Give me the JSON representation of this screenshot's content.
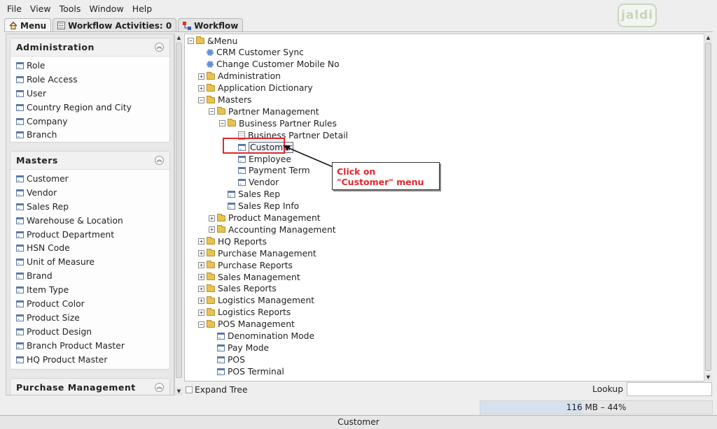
{
  "menubar": {
    "items": [
      "File",
      "View",
      "Tools",
      "Window",
      "Help"
    ]
  },
  "logo_text": "jaldi",
  "tabs": [
    {
      "label": "Menu",
      "icon": "home-icon"
    },
    {
      "label": "Workflow Activities: 0",
      "icon": "list-icon"
    },
    {
      "label": "Workflow",
      "icon": "workflow-icon"
    }
  ],
  "left": {
    "sections": [
      {
        "title": "Administration",
        "items": [
          "Role",
          "Role Access",
          "User",
          "Country Region and City",
          "Company",
          "Branch"
        ]
      },
      {
        "title": "Masters",
        "items": [
          "Customer",
          "Vendor",
          "Sales Rep",
          "Warehouse & Location",
          "Product Department",
          "HSN Code",
          "Unit of Measure",
          "Brand",
          "Item Type",
          "Product Color",
          "Product Size",
          "Product Design",
          "Branch Product Master",
          "HQ Product Master"
        ]
      },
      {
        "title": "Purchase Management",
        "items": []
      }
    ]
  },
  "tree": {
    "rows": [
      {
        "label": "&Menu",
        "level": 0,
        "type": "folder-open"
      },
      {
        "label": "CRM Customer Sync",
        "level": 1,
        "type": "process"
      },
      {
        "label": "Change Customer Mobile No",
        "level": 1,
        "type": "process"
      },
      {
        "label": "Administration",
        "level": 1,
        "type": "folder"
      },
      {
        "label": "Application Dictionary",
        "level": 1,
        "type": "folder"
      },
      {
        "label": "Masters",
        "level": 1,
        "type": "folder-open"
      },
      {
        "label": "Partner Management",
        "level": 2,
        "type": "folder-open"
      },
      {
        "label": "Business Partner Rules",
        "level": 3,
        "type": "folder-open"
      },
      {
        "label": "Business Partner Detail",
        "level": 4,
        "type": "report"
      },
      {
        "label": "Customer",
        "level": 4,
        "type": "window",
        "selected": true
      },
      {
        "label": "Employee",
        "level": 4,
        "type": "window"
      },
      {
        "label": "Payment Term",
        "level": 4,
        "type": "window"
      },
      {
        "label": "Vendor",
        "level": 4,
        "type": "window"
      },
      {
        "label": "Sales Rep",
        "level": 3,
        "type": "window"
      },
      {
        "label": "Sales Rep Info",
        "level": 3,
        "type": "window"
      },
      {
        "label": "Product Management",
        "level": 2,
        "type": "folder"
      },
      {
        "label": "Accounting Management",
        "level": 2,
        "type": "folder"
      },
      {
        "label": "HQ Reports",
        "level": 1,
        "type": "folder"
      },
      {
        "label": "Purchase Management",
        "level": 1,
        "type": "folder"
      },
      {
        "label": "Purchase Reports",
        "level": 1,
        "type": "folder"
      },
      {
        "label": "Sales Management",
        "level": 1,
        "type": "folder"
      },
      {
        "label": "Sales Reports",
        "level": 1,
        "type": "folder"
      },
      {
        "label": "Logistics Management",
        "level": 1,
        "type": "folder"
      },
      {
        "label": "Logistics Reports",
        "level": 1,
        "type": "folder"
      },
      {
        "label": "POS Management",
        "level": 1,
        "type": "folder-open"
      },
      {
        "label": "Denomination Mode",
        "level": 2,
        "type": "window"
      },
      {
        "label": "Pay Mode",
        "level": 2,
        "type": "window"
      },
      {
        "label": "POS",
        "level": 2,
        "type": "window"
      },
      {
        "label": "POS Terminal",
        "level": 2,
        "type": "window"
      }
    ]
  },
  "callout": {
    "text": "Click on \"Customer\" menu",
    "color": "#e4262c"
  },
  "footer": {
    "expand_tree_label": "Expand Tree",
    "lookup_label": "Lookup",
    "lookup_value": ""
  },
  "memory": {
    "text": "116 MB – 44%",
    "fraction": 0.44
  },
  "status": {
    "text": "Customer"
  }
}
